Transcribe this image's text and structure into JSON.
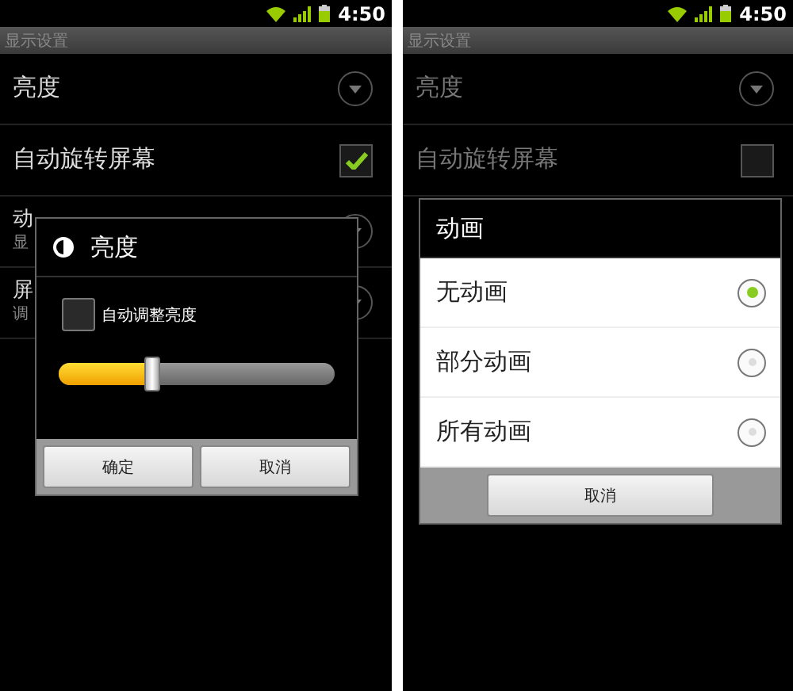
{
  "screens": [
    {
      "dimmed": false,
      "status_bar": {
        "time": "4:50"
      },
      "title": "显示设置",
      "settings": [
        {
          "kind": "dropdown",
          "title": "亮度"
        },
        {
          "kind": "checkbox",
          "title": "自动旋转屏幕",
          "checked": true
        },
        {
          "kind": "dropdown",
          "title": "动",
          "subtitle": "显"
        },
        {
          "kind": "dropdown",
          "title": "屏",
          "subtitle": "调"
        }
      ],
      "dialog": {
        "kind": "brightness",
        "title": "亮度",
        "auto": {
          "label": "自动调整亮度",
          "checked": false
        },
        "level": 0.34,
        "buttons": [
          "确定",
          "取消"
        ]
      }
    },
    {
      "dimmed": true,
      "status_bar": {
        "time": "4:50"
      },
      "title": "显示设置",
      "settings": [
        {
          "kind": "dropdown",
          "title": "亮度"
        },
        {
          "kind": "checkbox",
          "title": "自动旋转屏幕",
          "checked": false
        }
      ],
      "dialog": {
        "kind": "list",
        "title": "动画",
        "options": [
          {
            "label": "无动画",
            "selected": true
          },
          {
            "label": "部分动画",
            "selected": false
          },
          {
            "label": "所有动画",
            "selected": false
          }
        ],
        "buttons": [
          "取消"
        ]
      }
    }
  ]
}
